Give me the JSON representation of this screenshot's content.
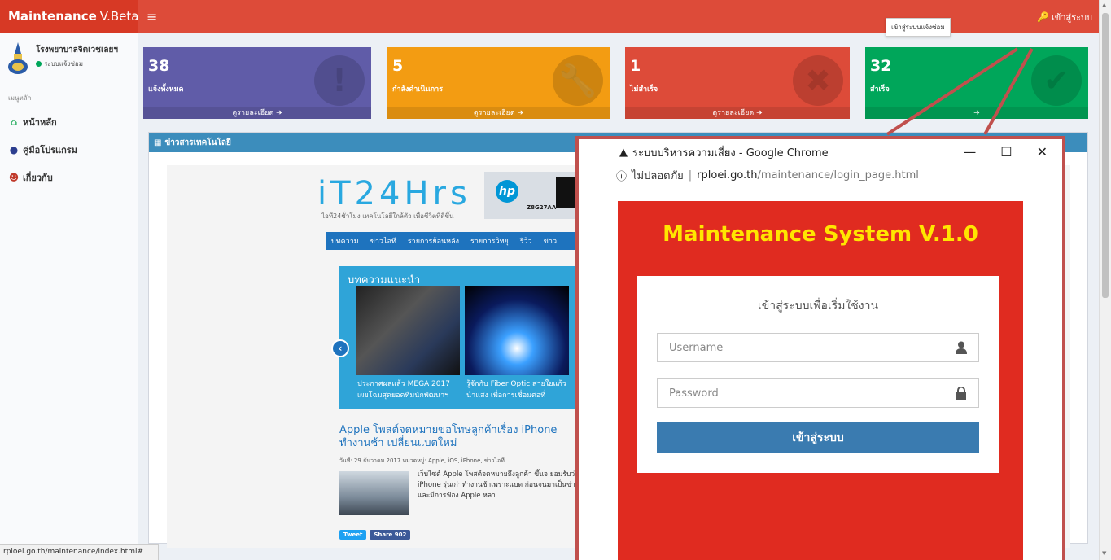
{
  "topbar": {
    "brand": "Maintenance",
    "brand_suffix": "V.Beta",
    "menu_icon": "hamburger-icon",
    "login_link": "เข้าสู่ระบบ"
  },
  "sidebar": {
    "hospital_name": "โรงพยาบาลจิตเวชเลยฯ",
    "status_text": "ระบบแจ้งซ่อม",
    "menu_header": "เมนูหลัก",
    "items": [
      {
        "label": "หน้าหลัก",
        "icon": "home-icon"
      },
      {
        "label": "คู่มือโปรแกรม",
        "icon": "book-icon"
      },
      {
        "label": "เกี่ยวกับ",
        "icon": "about-icon"
      }
    ]
  },
  "stats": [
    {
      "number": "38",
      "label": "แจ้งทั้งหมด",
      "footer": "ดูรายละเอียด ➔",
      "color": "#605ca8",
      "icon": "exclamation-icon"
    },
    {
      "number": "5",
      "label": "กำลังดำเนินการ",
      "footer": "ดูรายละเอียด ➔",
      "color": "#f39c12",
      "icon": "wrench-icon"
    },
    {
      "number": "1",
      "label": "ไม่สำเร็จ",
      "footer": "ดูรายละเอียด ➔",
      "color": "#dd4b39",
      "icon": "times-circle-icon"
    },
    {
      "number": "32",
      "label": "สำเร็จ",
      "footer": "➔",
      "color": "#00a65a",
      "icon": "check-circle-icon"
    }
  ],
  "tooltip": "เข้าสู่ระบบแจ้งซ่อม",
  "news": {
    "header": "ข่าวสารเทคโนโลยี",
    "site_logo": "iT24Hrs",
    "site_tagline": "ไอที24ชั่วโมง เทคโนโลยีใกล้ตัว เพื่อชีวิตที่ดีขึ้น",
    "ad_model": "Z8G27AA",
    "nav_items": [
      "บทความ",
      "ข่าวไอที",
      "รายการย้อนหลัง",
      "รายการวิทยุ",
      "รีวิว",
      "ข่าว"
    ],
    "featured_title": "บทความแนะนำ",
    "featured_caption_1": "ประกาศผลแล้ว MEGA 2017 เผยโฉมสุดยอดทีมนักพัฒนาฯ",
    "featured_caption_2": "รู้จักกับ Fiber Optic สายใยแก้วนำแสง เพื่อการเชื่อมต่อที่",
    "article_title": "Apple โพสต์จดหมายขอโทษลูกค้าเรื่อง iPhone ทำงานช้า เปลี่ยนแบตใหม่",
    "article_meta": "วันที่: 29 ธันวาคม 2017 หมวดหมู่: Apple, iOS, iPhone, ข่าวไอที",
    "article_text": "เว็บไซต์ Apple โพสต์จดหมายถึงลูกค้า ขึ้นจ ยอมรับว่า iPhone รุ่นเก่าทำงานช้าเพราะแบต ก่อนจนมาเป็นข่าวและมีการฟ้อง Apple หลา",
    "tweet_label": "Tweet",
    "share_label": "Share 902"
  },
  "status_bar": "rploei.go.th/maintenance/index.html#",
  "popup": {
    "window_title": "ระบบบริหารความเสี่ยง - Google Chrome",
    "insecure_label": "ไม่ปลอดภัย",
    "url_host": "rploei.go.th",
    "url_path": "/maintenance/login_page.html",
    "system_title": "Maintenance System V.1.0",
    "login_message": "เข้าสู่ระบบเพื่อเริ่มใช้งาน",
    "username_placeholder": "Username",
    "password_placeholder": "Password",
    "login_button": "เข้าสู่ระบบ",
    "title_color": "#ffe600",
    "background_color": "#e02b20",
    "button_color": "#3a7bb0"
  }
}
